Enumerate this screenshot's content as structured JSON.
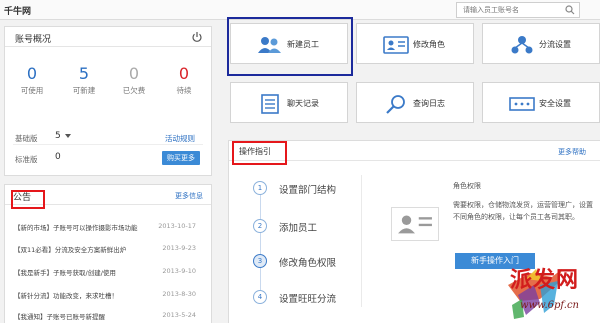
{
  "app": {
    "logo": "千牛网"
  },
  "search": {
    "placeholder": "请输入员工账号名"
  },
  "account": {
    "title": "账号概况",
    "stats": [
      {
        "value": "0",
        "label": "可使用",
        "color": "#2b6fc2"
      },
      {
        "value": "5",
        "label": "可新建",
        "color": "#2b6fc2"
      },
      {
        "value": "0",
        "label": "已欠费",
        "color": "#aaaaaa"
      },
      {
        "value": "0",
        "label": "待续",
        "color": "#d9242a"
      }
    ],
    "edition_label": "基础版",
    "edition_value": "5",
    "edition_link": "活动规则",
    "standard_label": "标准版",
    "standard_value": "0",
    "buy_button": "购买更多"
  },
  "notice": {
    "title": "公告",
    "more": "更多信息",
    "items": [
      {
        "text": "【新的市场】子账号可以操作摄影市场功能",
        "date": "2013-10-17"
      },
      {
        "text": "【双11必看】分流及安全方案新鲜出炉",
        "date": "2013-9-23"
      },
      {
        "text": "【我是新手】子账号获取/创建/使用",
        "date": "2013-9-10"
      },
      {
        "text": "【新针分流】功能改变，来求吐槽！",
        "date": "2013-8-30"
      },
      {
        "text": "【我通知】子账号已账号新提醒",
        "date": "2013-5-24"
      }
    ]
  },
  "tiles": [
    {
      "label": "新建员工",
      "icon": "users-icon"
    },
    {
      "label": "修改角色",
      "icon": "id-card-icon"
    },
    {
      "label": "分流设置",
      "icon": "network-icon"
    },
    {
      "label": "聊天记录",
      "icon": "document-icon"
    },
    {
      "label": "查询日志",
      "icon": "search-icon"
    },
    {
      "label": "安全设置",
      "icon": "dots-box-icon"
    }
  ],
  "guide": {
    "title": "操作指引",
    "more": "更多帮助",
    "steps": [
      {
        "num": "1",
        "text": "设置部门结构"
      },
      {
        "num": "2",
        "text": "添加员工"
      },
      {
        "num": "3",
        "text": "修改角色权限"
      },
      {
        "num": "4",
        "text": "设置旺旺分流"
      }
    ],
    "desc_title": "角色权限",
    "desc": "需要权限，仓储物流发货，运营管理广，设置不同角色的权限，让每个员工各司其职。",
    "button": "新手操作入门"
  },
  "watermark": {
    "text": "派发网",
    "url": "www.6pf.cn"
  }
}
